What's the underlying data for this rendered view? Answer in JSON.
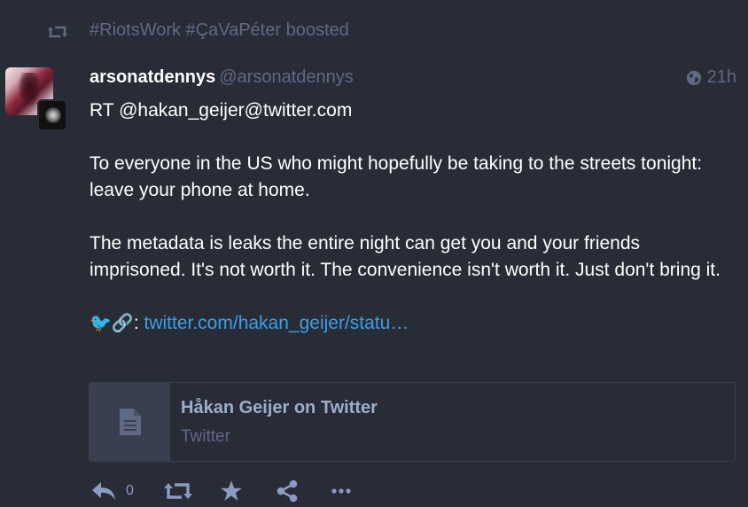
{
  "prepend": {
    "icon": "boost-icon",
    "text": "#RiotsWork #ÇaVaPéter boosted"
  },
  "status": {
    "display_name": "arsonatdennys",
    "acct": "@arsonatdennys",
    "visibility_icon": "globe-icon",
    "time": "21h",
    "paragraphs": [
      "RT @hakan_geijer@twitter.com",
      "To everyone in the US who might hopefully be taking to the streets tonight: leave your phone at home.",
      "The metadata is leaks the entire night can get you and your friends imprisoned. It's not worth it. The convenience isn't worth it. Just don't bring it."
    ],
    "emoji_prefix": "🐦🔗",
    "colon": ":",
    "link_text": "twitter.com/hakan_geijer/statu…"
  },
  "card": {
    "icon": "file-icon",
    "title": "Håkan Geijer on Twitter",
    "provider": "Twitter"
  },
  "actions": {
    "reply_count": "0"
  },
  "colors": {
    "background": "#282c37",
    "muted": "#606984",
    "link": "#3d9ee6",
    "card_border": "#393f4f",
    "card_title": "#9baec8"
  }
}
